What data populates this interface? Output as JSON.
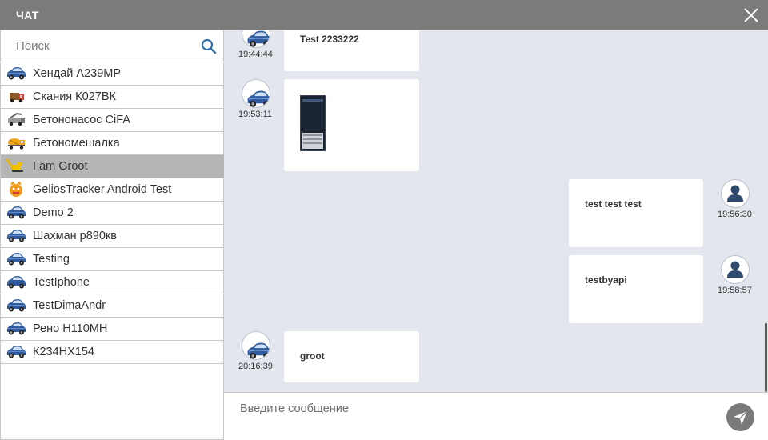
{
  "window": {
    "title": "ЧАТ"
  },
  "search": {
    "placeholder": "Поиск"
  },
  "contacts": [
    {
      "label": "Хендай А239МР",
      "icon": "blue-car-icon"
    },
    {
      "label": "Скания К027ВК",
      "icon": "truck-icon"
    },
    {
      "label": "Бетононасос CiFA",
      "icon": "concrete-pump-icon"
    },
    {
      "label": "Бетономешалка",
      "icon": "concrete-mixer-icon"
    },
    {
      "label": "I am Groot",
      "icon": "excavator-icon",
      "selected": true
    },
    {
      "label": "GeliosTracker Android Test",
      "icon": "smiley-icon"
    },
    {
      "label": "Demo 2",
      "icon": "blue-car-icon"
    },
    {
      "label": "Шахман р890кв",
      "icon": "blue-car-icon"
    },
    {
      "label": "Testing",
      "icon": "blue-car-icon"
    },
    {
      "label": "TestIphone",
      "icon": "blue-car-icon"
    },
    {
      "label": "TestDimaAndr",
      "icon": "blue-car-icon"
    },
    {
      "label": "Рено Н110МН",
      "icon": "blue-car-icon"
    },
    {
      "label": "К234НХ154",
      "icon": "blue-car-icon"
    }
  ],
  "messages": [
    {
      "time": "19:44:44",
      "text": "Test 2233222",
      "direction": "incoming",
      "avatar": "blue-car-icon"
    },
    {
      "time": "19:53:11",
      "text": "",
      "direction": "incoming",
      "attachment": "phone-screenshot-thumbnail",
      "avatar": "blue-car-icon"
    },
    {
      "time": "19:56:30",
      "text": "test test test",
      "direction": "outgoing",
      "avatar": "user-icon"
    },
    {
      "time": "19:58:57",
      "text": "testbyapi",
      "direction": "outgoing",
      "avatar": "user-icon"
    },
    {
      "time": "20:16:39",
      "text": "groot",
      "direction": "incoming",
      "avatar": "blue-car-icon"
    }
  ],
  "composer": {
    "placeholder": "Введите сообщение"
  },
  "icons": {
    "close": "close-icon",
    "search": "search-icon",
    "send": "send-icon"
  },
  "colors": {
    "titlebar": "#7b7b7b",
    "chat_background": "#e3e6ec",
    "selected_row": "#b5b5b5",
    "send_button": "#7a7a7a"
  }
}
